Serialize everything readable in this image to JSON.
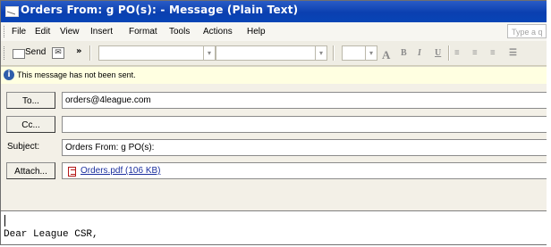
{
  "window": {
    "title": "Orders From: g PO(s): - Message (Plain Text)"
  },
  "menu": {
    "items": [
      "File",
      "Edit",
      "View",
      "Insert",
      "Format",
      "Tools",
      "Actions",
      "Help"
    ],
    "question_placeholder": "Type a q"
  },
  "toolbar": {
    "send_label": "Send",
    "overflow_label": "»"
  },
  "notice": {
    "text": "This message has not been sent."
  },
  "fields": {
    "to_label": "To...",
    "to_value": "orders@4league.com",
    "cc_label": "Cc...",
    "cc_value": "",
    "subject_label": "Subject:",
    "subject_value": "Orders From: g PO(s):",
    "attach_label": "Attach...",
    "attachment": "Orders.pdf (106 KB)"
  },
  "message": {
    "body": "Dear League CSR,"
  },
  "icons": {
    "title_icon": "envelope-icon",
    "info_icon": "info-icon",
    "attachment_icon": "pdf-icon"
  },
  "colors": {
    "title_bar": "#0a3fb0",
    "notice_background": "#ffffe1",
    "link": "#1b2f9e"
  }
}
